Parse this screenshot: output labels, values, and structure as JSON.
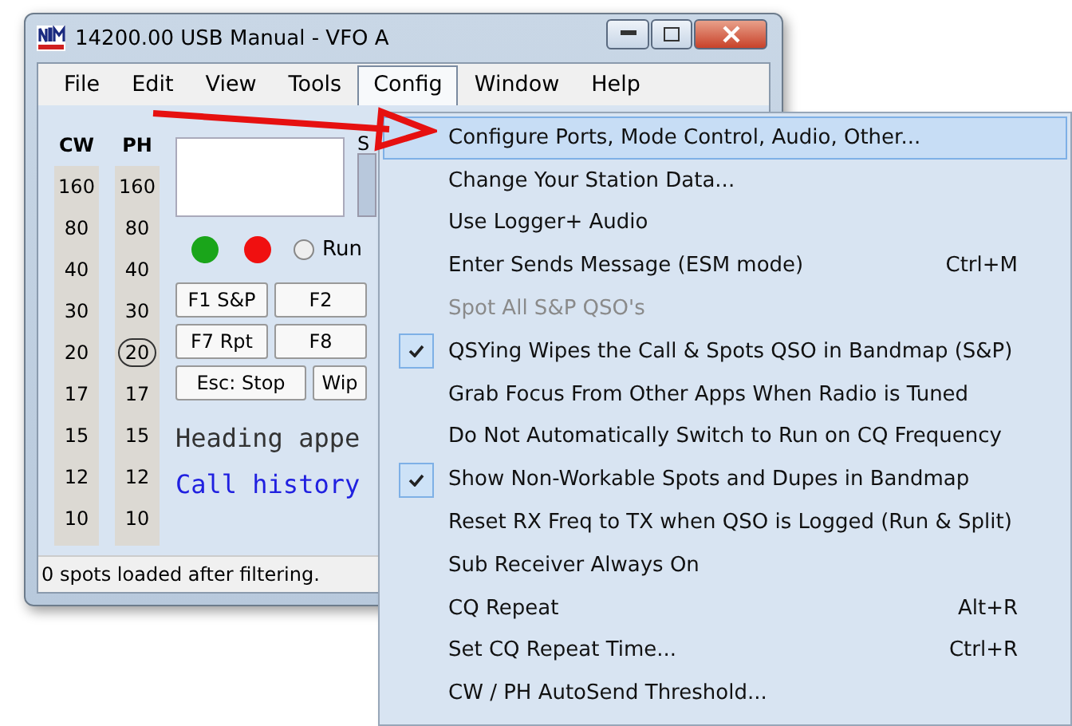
{
  "window": {
    "title": "14200.00 USB Manual - VFO A"
  },
  "menu_bar": [
    {
      "label": "File",
      "selected": false
    },
    {
      "label": "Edit",
      "selected": false
    },
    {
      "label": "View",
      "selected": false
    },
    {
      "label": "Tools",
      "selected": false
    },
    {
      "label": "Config",
      "selected": true
    },
    {
      "label": "Window",
      "selected": false
    },
    {
      "label": "Help",
      "selected": false
    }
  ],
  "bands": [
    {
      "header": "CW",
      "values": [
        {
          "label": "160",
          "selected": false
        },
        {
          "label": "80",
          "selected": false
        },
        {
          "label": "40",
          "selected": false
        },
        {
          "label": "30",
          "selected": false
        },
        {
          "label": "20",
          "selected": false
        },
        {
          "label": "17",
          "selected": false
        },
        {
          "label": "15",
          "selected": false
        },
        {
          "label": "12",
          "selected": false
        },
        {
          "label": "10",
          "selected": false
        }
      ]
    },
    {
      "header": "PH",
      "values": [
        {
          "label": "160",
          "selected": false
        },
        {
          "label": "80",
          "selected": false
        },
        {
          "label": "40",
          "selected": false
        },
        {
          "label": "30",
          "selected": false
        },
        {
          "label": "20",
          "selected": true
        },
        {
          "label": "17",
          "selected": false
        },
        {
          "label": "15",
          "selected": false
        },
        {
          "label": "12",
          "selected": false
        },
        {
          "label": "10",
          "selected": false
        }
      ]
    }
  ],
  "panel_label": "S",
  "indicators": [
    {
      "color": "#1aa51a"
    },
    {
      "color": "#f01010"
    }
  ],
  "run_radio": {
    "label": "Run",
    "checked": false
  },
  "function_keys": [
    [
      "F1 S&P",
      "F2"
    ],
    [
      "F7 Rpt",
      "F8"
    ],
    [
      "Esc: Stop",
      "Wip"
    ]
  ],
  "messages": [
    {
      "kind": "plain",
      "text": "Heading appe"
    },
    {
      "kind": "link",
      "text": "Call history"
    }
  ],
  "status_bar": "0 spots loaded after filtering.",
  "dropdown": [
    {
      "label": "Configure Ports, Mode Control, Audio, Other...",
      "selected": true,
      "checked": false,
      "disabled": false
    },
    {
      "label": "Change Your Station Data...",
      "selected": false,
      "checked": false,
      "disabled": false
    },
    {
      "label": "Use Logger+ Audio",
      "selected": false,
      "checked": false,
      "disabled": false
    },
    {
      "label": "Enter Sends Message (ESM mode)",
      "shortcut": "Ctrl+M",
      "selected": false,
      "checked": false,
      "disabled": false
    },
    {
      "label": "Spot All S&P QSO's",
      "selected": false,
      "checked": false,
      "disabled": true
    },
    {
      "label": "QSYing Wipes the Call & Spots QSO in Bandmap (S&P)",
      "selected": false,
      "checked": true,
      "disabled": false
    },
    {
      "label": "Grab Focus From Other Apps When Radio is Tuned",
      "selected": false,
      "checked": false,
      "disabled": false
    },
    {
      "label": "Do Not Automatically Switch to Run on CQ Frequency",
      "selected": false,
      "checked": false,
      "disabled": false
    },
    {
      "label": "Show Non-Workable Spots and Dupes in Bandmap",
      "selected": false,
      "checked": true,
      "disabled": false
    },
    {
      "label": "Reset RX Freq to TX when QSO is Logged (Run & Split)",
      "selected": false,
      "checked": false,
      "disabled": false
    },
    {
      "label": "Sub Receiver Always On",
      "selected": false,
      "checked": false,
      "disabled": false
    },
    {
      "label": "CQ Repeat",
      "shortcut": "Alt+R",
      "selected": false,
      "checked": false,
      "disabled": false
    },
    {
      "label": "Set CQ Repeat Time...",
      "shortcut": "Ctrl+R",
      "selected": false,
      "checked": false,
      "disabled": false
    },
    {
      "label": "CW / PH AutoSend Threshold...",
      "selected": false,
      "checked": false,
      "disabled": false
    }
  ]
}
